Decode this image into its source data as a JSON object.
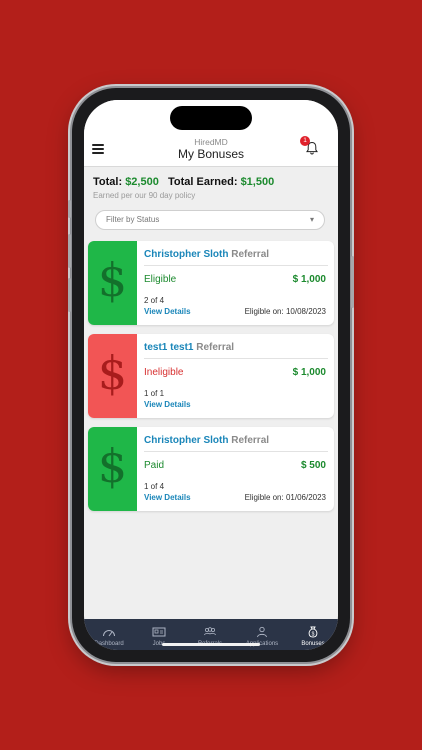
{
  "header": {
    "brand": "HiredMD",
    "title": "My Bonuses",
    "notification_count": "1"
  },
  "summary": {
    "total_label": "Total:",
    "total_value": "$2,500",
    "earned_label": "Total Earned:",
    "earned_value": "$1,500",
    "policy": "Earned per our 90 day policy"
  },
  "filter": {
    "placeholder": "Filter by Status",
    "caret": "▾"
  },
  "colors": {
    "eligible": "#1fb748",
    "ineligible": "#f25555",
    "eligible_text": "#1c8a2e",
    "ineligible_text": "#d73030"
  },
  "cards": [
    {
      "name": "Christopher Sloth",
      "type": "Referral",
      "status": "Eligible",
      "amount": "$ 1,000",
      "count": "2 of 4",
      "view": "View Details",
      "eligible_on": "Eligible on: 10/08/2023",
      "symbol": "$"
    },
    {
      "name": "test1 test1",
      "type": "Referral",
      "status": "Ineligible",
      "amount": "$ 1,000",
      "count": "1 of 1",
      "view": "View Details",
      "eligible_on": "",
      "symbol": "$"
    },
    {
      "name": "Christopher Sloth",
      "type": "Referral",
      "status": "Paid",
      "amount": "$ 500",
      "count": "1 of 4",
      "view": "View Details",
      "eligible_on": "Eligible on: 01/06/2023",
      "symbol": "$"
    }
  ],
  "tabs": [
    {
      "label": "Dashboard",
      "icon": "dashboard-gauge-icon"
    },
    {
      "label": "Jobs",
      "icon": "jobs-id-card-icon"
    },
    {
      "label": "Referrals",
      "icon": "referrals-people-icon"
    },
    {
      "label": "Applications",
      "icon": "applications-person-icon"
    },
    {
      "label": "Bonuses",
      "icon": "bonuses-money-bag-icon"
    }
  ]
}
